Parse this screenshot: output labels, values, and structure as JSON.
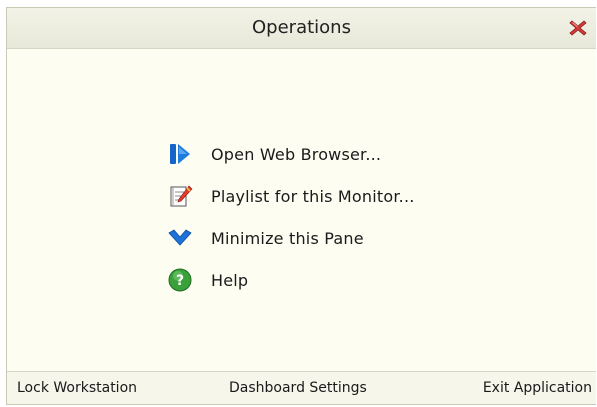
{
  "window": {
    "title": "Operations",
    "close_icon": "close-icon"
  },
  "menu": {
    "items": [
      {
        "label": "Open Web Browser...",
        "icon": "web-browser-icon"
      },
      {
        "label": "Playlist for this Monitor...",
        "icon": "playlist-icon"
      },
      {
        "label": "Minimize this Pane",
        "icon": "chevron-down-icon"
      },
      {
        "label": "Help",
        "icon": "help-icon"
      }
    ]
  },
  "footer": {
    "lock_label": "Lock Workstation",
    "settings_label": "Dashboard Settings",
    "exit_label": "Exit Application"
  },
  "colors": {
    "panel_bg": "#fdfdf2",
    "title_bg": "#ecece0",
    "accent_blue": "#1a6fd6",
    "help_green": "#3aa13a",
    "close_red": "#d03030"
  }
}
